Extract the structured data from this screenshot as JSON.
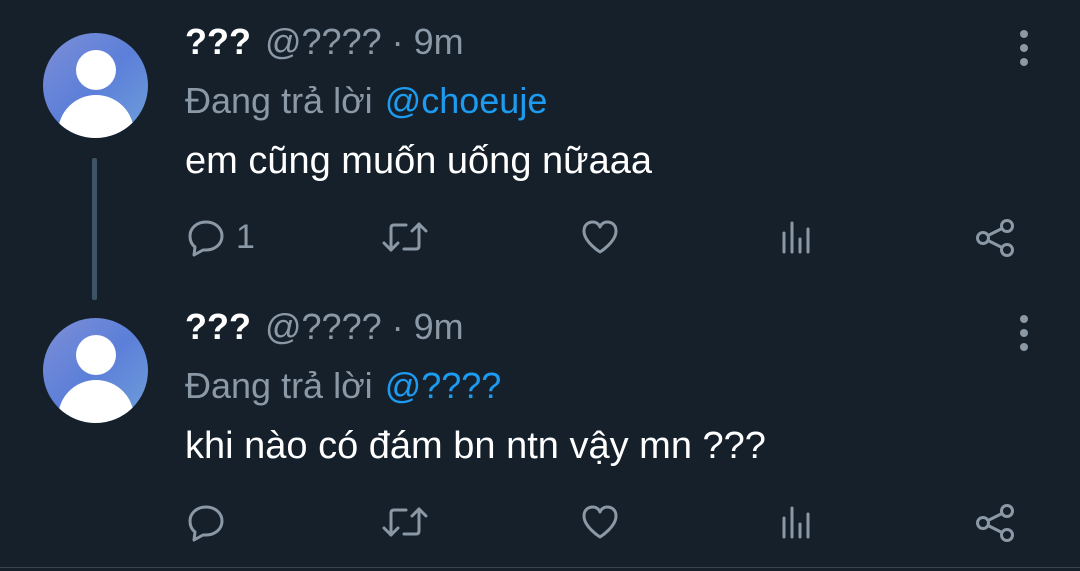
{
  "tweets": [
    {
      "name": "???",
      "handle": "@????",
      "separator": "·",
      "time": "9m",
      "reply_prefix": "Đang trả lời",
      "reply_to": "@choeuje",
      "text": "em cũng muốn uống nữaaa",
      "reply_count": "1"
    },
    {
      "name": "???",
      "handle": "@????",
      "separator": "·",
      "time": "9m",
      "reply_prefix": "Đang trả lời",
      "reply_to": "@????",
      "text": "khi nào có đám bn ntn vậy mn ???",
      "reply_count": ""
    }
  ],
  "icons": {
    "reply": "reply-icon",
    "retweet": "retweet-icon",
    "like": "heart-icon",
    "views": "views-icon",
    "share": "share-icon",
    "more": "more-vertical-icon",
    "avatar": "default-avatar"
  },
  "colors": {
    "background": "#15202b",
    "text_primary": "#ffffff",
    "text_secondary": "#8b98a5",
    "link": "#1d9bf0",
    "thread_line": "#3d5466"
  }
}
